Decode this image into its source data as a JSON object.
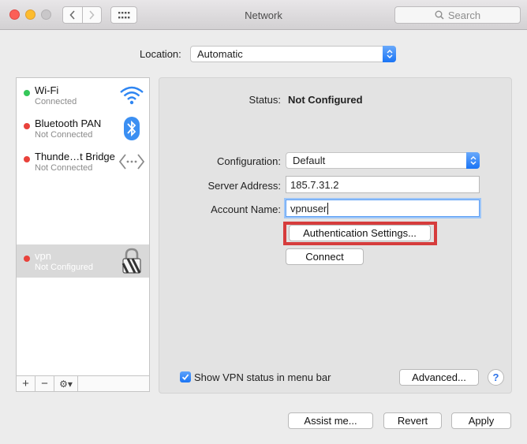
{
  "window": {
    "title": "Network"
  },
  "toolbar": {
    "search_placeholder": "Search"
  },
  "location": {
    "label": "Location:",
    "value": "Automatic"
  },
  "services": [
    {
      "name": "Wi-Fi",
      "status": "Connected",
      "status_color": "#35c759",
      "icon": "wifi-icon"
    },
    {
      "name": "Bluetooth PAN",
      "status": "Not Connected",
      "status_color": "#e9423b",
      "icon": "bluetooth-icon"
    },
    {
      "name": "Thunde…t Bridge",
      "status": "Not Connected",
      "status_color": "#e9423b",
      "icon": "thunderbolt-bridge-icon"
    },
    {
      "name": "vpn",
      "status": "Not Configured",
      "status_color": "#e9423b",
      "icon": "vpn-lock-icon",
      "selected": true
    }
  ],
  "sidebar_tools": {
    "add": "+",
    "remove": "−",
    "actions": "⚙▾"
  },
  "detail": {
    "status_label": "Status:",
    "status_value": "Not Configured",
    "configuration_label": "Configuration:",
    "configuration_value": "Default",
    "server_label": "Server Address:",
    "server_value": "185.7.31.2",
    "account_label": "Account Name:",
    "account_value": "vpnuser",
    "auth_button": "Authentication Settings...",
    "connect_button": "Connect",
    "show_status_label": "Show VPN status in menu bar",
    "show_status_checked": true,
    "advanced_button": "Advanced...",
    "help_button": "?"
  },
  "footer": {
    "assist": "Assist me...",
    "revert": "Revert",
    "apply": "Apply"
  },
  "colors": {
    "accent": "#1b74f4",
    "highlight_box": "#d63c3c"
  }
}
